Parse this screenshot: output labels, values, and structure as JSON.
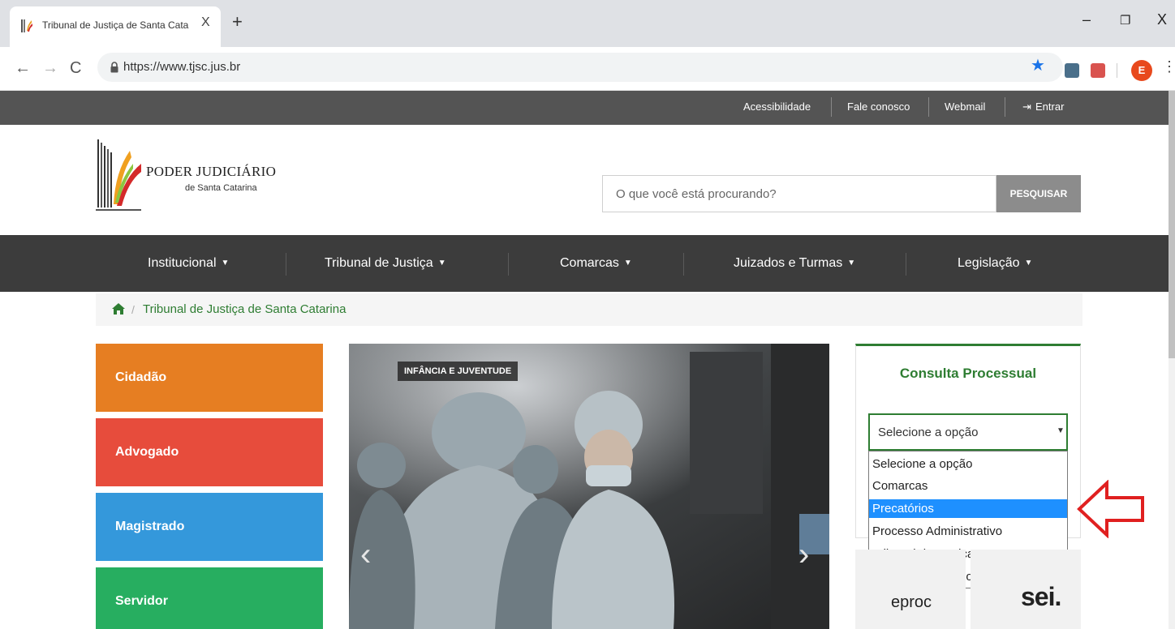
{
  "browser": {
    "tab_title": "Tribunal de Justiça de Santa Cata",
    "tab_close": "X",
    "new_tab": "+",
    "url": "https://www.tjsc.jus.br",
    "minimize": "–",
    "maximize": "❐",
    "close": "X",
    "profile_initial": "E"
  },
  "utility_bar": {
    "links": [
      "Acessibilidade",
      "Fale conosco",
      "Webmail",
      "Entrar"
    ]
  },
  "header": {
    "logo_line1": "PODER JUDICIÁRIO",
    "logo_line2": "de Santa Catarina",
    "search_placeholder": "O que você está procurando?",
    "search_button": "PESQUISAR"
  },
  "main_nav": {
    "items": [
      "Institucional",
      "Tribunal de Justiça",
      "Comarcas",
      "Juizados e Turmas",
      "Legislação"
    ]
  },
  "breadcrumb": {
    "separator": "/",
    "current": "Tribunal de Justiça de Santa Catarina"
  },
  "profiles": [
    {
      "label": "Cidadão",
      "color": "#e67e22"
    },
    {
      "label": "Advogado",
      "color": "#e74c3c"
    },
    {
      "label": "Magistrado",
      "color": "#3498db"
    },
    {
      "label": "Servidor",
      "color": "#27ae60"
    }
  ],
  "carousel": {
    "tag": "INFÂNCIA E JUVENTUDE",
    "prev": "‹",
    "next": "›"
  },
  "consulta": {
    "title": "Consulta Processual",
    "select_value": "Selecione a opção",
    "options": [
      "Selecione a opção",
      "Comarcas",
      "Precatórios",
      "Processo Administrativo",
      "Tribunal de Justiça",
      "Turma de Recursos"
    ],
    "highlighted_option": "Precatórios"
  },
  "systems": {
    "eproc": "eproc",
    "sei": "sei."
  },
  "colors": {
    "accent_green": "#2e7d32",
    "utility_bar": "#545454",
    "main_nav": "#3c3c3c",
    "selected_option": "#1e90ff",
    "arrow_red": "#e02020"
  }
}
